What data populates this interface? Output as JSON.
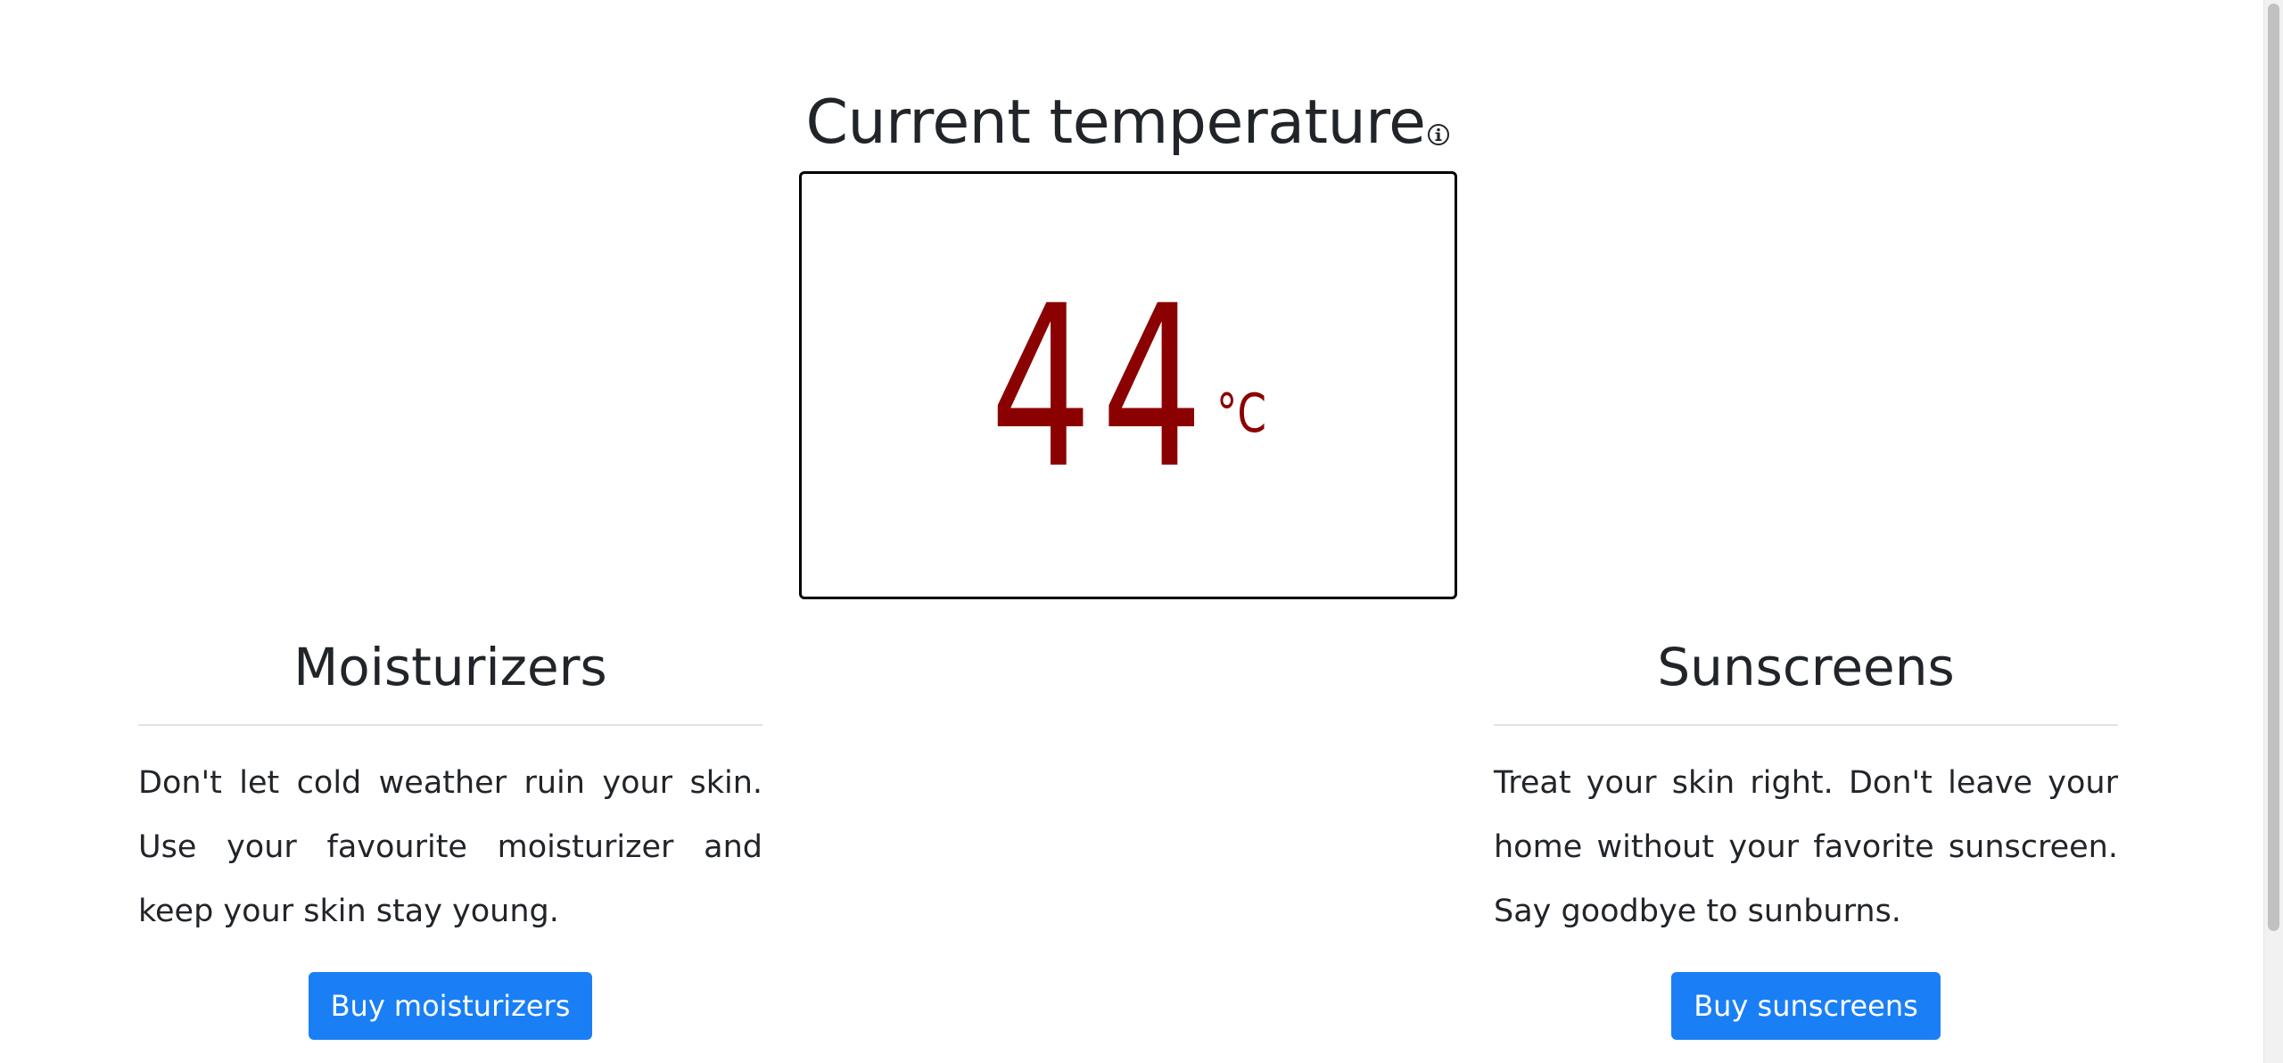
{
  "temperature": {
    "heading": "Current temperature",
    "value": "44",
    "unit": "°C",
    "value_color": "#8b0000"
  },
  "moisturizers": {
    "title": "Moisturizers",
    "description": "Don't let cold weather ruin your skin. Use your favourite moisturizer and keep your skin stay young.",
    "button_label": "Buy moisturizers"
  },
  "sunscreens": {
    "title": "Sunscreens",
    "description": "Treat your skin right. Don't leave your home without your favorite sunscreen. Say goodbye to sunburns.",
    "button_label": "Buy sunscreens"
  },
  "theme": {
    "button_color": "#1a7ff5",
    "text_color": "#212529"
  },
  "icons": {
    "info": "info-icon"
  }
}
